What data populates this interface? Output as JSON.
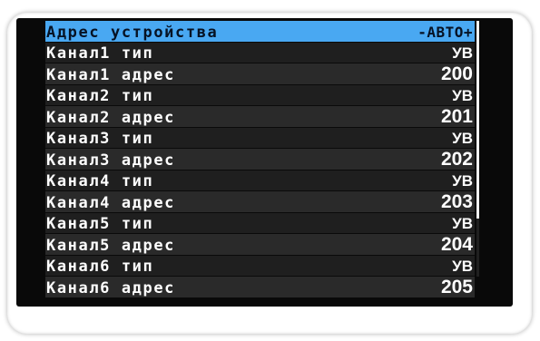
{
  "menu": {
    "header": {
      "label": "Адрес устройства",
      "value": "-АВТО+"
    },
    "rows": [
      {
        "label": "Канал1 тип",
        "value": "УВ"
      },
      {
        "label": "Канал1 адрес",
        "value": "200"
      },
      {
        "label": "Канал2 тип",
        "value": "УВ"
      },
      {
        "label": "Канал2 адрес",
        "value": "201"
      },
      {
        "label": "Канал3 тип",
        "value": "УВ"
      },
      {
        "label": "Канал3 адрес",
        "value": "202"
      },
      {
        "label": "Канал4 тип",
        "value": "УВ"
      },
      {
        "label": "Канал4 адрес",
        "value": "203"
      },
      {
        "label": "Канал5 тип",
        "value": "УВ"
      },
      {
        "label": "Канал5 адрес",
        "value": "204"
      },
      {
        "label": "Канал6 тип",
        "value": "УВ"
      },
      {
        "label": "Канал6 адрес",
        "value": "205"
      }
    ]
  },
  "colors": {
    "selection": "#49a8f2",
    "screen_background": "#090909",
    "text": "#ffffff"
  }
}
